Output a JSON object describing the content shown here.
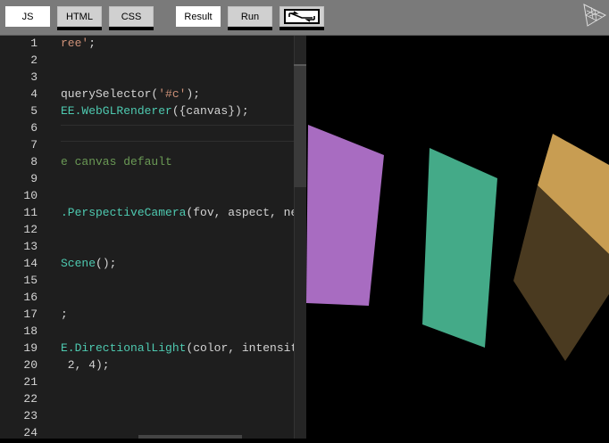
{
  "toolbar": {
    "tabs": [
      {
        "label": "JS"
      },
      {
        "label": "HTML"
      },
      {
        "label": "CSS"
      },
      {
        "label": "Result"
      },
      {
        "label": "Run"
      }
    ],
    "popout_icon": "expand-window-icon",
    "logo_icon": "threejs-logo-icon"
  },
  "editor": {
    "line_numbers": [
      "1",
      "2",
      "3",
      "4",
      "5",
      "6",
      "7",
      "8",
      "9",
      "10",
      "11",
      "12",
      "13",
      "14",
      "15",
      "16",
      "17",
      "18",
      "19",
      "20",
      "21",
      "22",
      "23",
      "24"
    ],
    "lines": [
      {
        "n": 1,
        "parts": [
          {
            "t": "ree'",
            "c": "str"
          },
          {
            "t": ";",
            "c": ""
          }
        ]
      },
      {
        "n": 4,
        "parts": [
          {
            "t": "querySelector(",
            "c": ""
          },
          {
            "t": "'#c'",
            "c": "str"
          },
          {
            "t": ");",
            "c": ""
          }
        ]
      },
      {
        "n": 5,
        "parts": [
          {
            "t": "EE.",
            "c": "cls"
          },
          {
            "t": "WebGLRenderer",
            "c": "cls"
          },
          {
            "t": "({canvas});",
            "c": ""
          }
        ]
      },
      {
        "n": 8,
        "parts": [
          {
            "t": "e canvas default",
            "c": "cmt"
          }
        ]
      },
      {
        "n": 11,
        "parts": [
          {
            "t": ".PerspectiveCamera",
            "c": "cls"
          },
          {
            "t": "(fov, aspect, nea",
            "c": ""
          }
        ]
      },
      {
        "n": 14,
        "parts": [
          {
            "t": "Scene",
            "c": "cls"
          },
          {
            "t": "();",
            "c": ""
          }
        ]
      },
      {
        "n": 17,
        "parts": [
          {
            "t": ";",
            "c": ""
          }
        ]
      },
      {
        "n": 19,
        "parts": [
          {
            "t": "E.DirectionalLight",
            "c": "cls"
          },
          {
            "t": "(color, intensity",
            "c": ""
          }
        ]
      },
      {
        "n": 20,
        "parts": [
          {
            "t": " 2, 4);",
            "c": ""
          }
        ]
      }
    ]
  },
  "colors": {
    "toolbar_bg": "#7a7a7a",
    "editor_bg": "#1e1e1e",
    "purple_cube": "#a86cc1",
    "green_cube": "#44aa88",
    "gold_cube": "#c89d52"
  }
}
